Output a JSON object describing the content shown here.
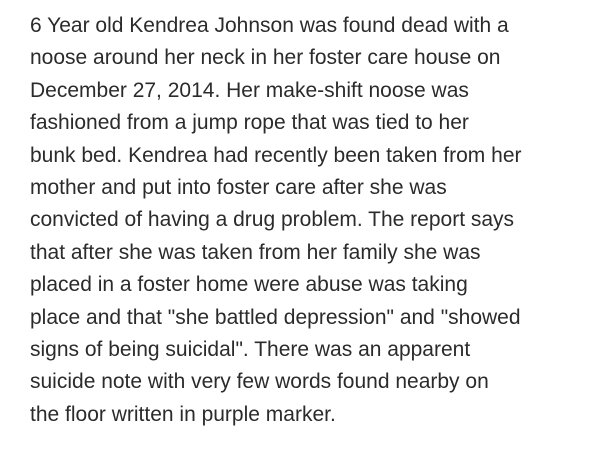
{
  "article": {
    "lines": [
      "6 Year old Kendrea Johnson was found dead with a",
      "noose around her neck in her foster care house on",
      "December 27, 2014. Her make-shift noose was",
      "fashioned from a jump rope that was tied to her",
      "bunk bed. Kendrea had recently been taken from her",
      "mother and put into foster care after she was",
      "convicted of having a drug problem. The report says",
      "that after she was taken from her family she was",
      "placed in a foster home were abuse was taking",
      "place and that \"she battled depression\" and \"showed",
      "signs of being suicidal\". There was an apparent",
      "suicide note with very few words found nearby on",
      "the floor written in purple marker."
    ]
  }
}
